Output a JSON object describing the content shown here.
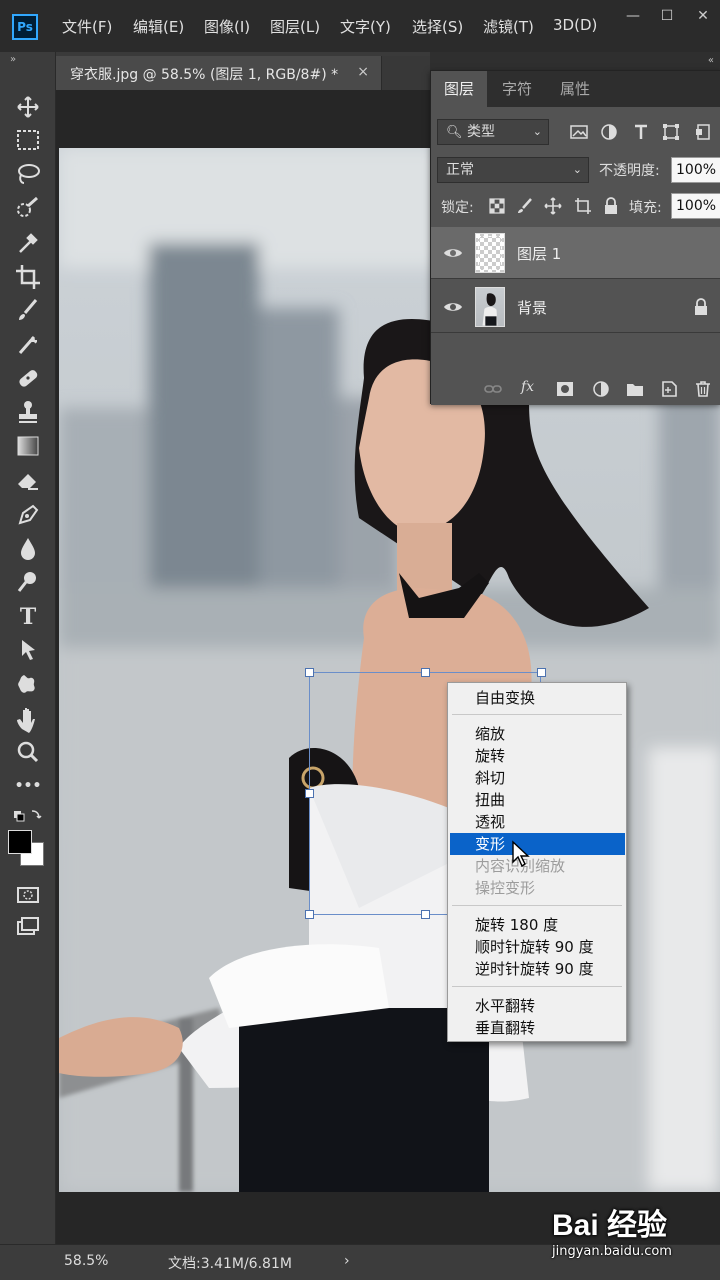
{
  "app": {
    "logo": "Ps"
  },
  "menubar": {
    "items": [
      "文件(F)",
      "编辑(E)",
      "图像(I)",
      "图层(L)",
      "文字(Y)",
      "选择(S)",
      "滤镜(T)",
      "3D(D)"
    ],
    "window_controls": [
      "—",
      "☐",
      "✕"
    ]
  },
  "document": {
    "tab_title": "穿衣服.jpg @ 58.5% (图层 1, RGB/8#) *",
    "tab_close": "×"
  },
  "toolbox": {
    "collapse": "»",
    "tools": [
      "move-tool",
      "marquee-tool",
      "lasso-tool",
      "quick-selection-tool",
      "eyedropper-tool",
      "crop-tool",
      "brush-tool",
      "healing-tool",
      "patch-tool",
      "stamp-tool",
      "gradient-tool",
      "eraser-tool",
      "pen-tool",
      "blur-tool",
      "dodge-tool",
      "type-tool",
      "path-selection-tool",
      "shape-tool",
      "hand-tool",
      "zoom-tool",
      "more-tools"
    ],
    "type_tool_glyph": "T",
    "more_glyph": "•••",
    "foreground_color": "#000000",
    "background_color": "#ffffff"
  },
  "layers_panel": {
    "collapse": "«",
    "tabs": [
      "图层",
      "字符",
      "属性"
    ],
    "active_tab": "图层",
    "filter": {
      "label": "类型"
    },
    "blend_mode": "正常",
    "opacity_label": "不透明度:",
    "opacity_value": "100%",
    "lock_label": "锁定:",
    "fill_label": "填充:",
    "fill_value": "100%",
    "layers": [
      {
        "name": "图层 1",
        "visible": true,
        "selected": true,
        "locked": false
      },
      {
        "name": "背景",
        "visible": true,
        "selected": false,
        "locked": true
      }
    ],
    "footer_fx": "fx"
  },
  "context_menu": {
    "groups": [
      [
        {
          "label": "自由变换",
          "enabled": true
        }
      ],
      [
        {
          "label": "缩放",
          "enabled": true
        },
        {
          "label": "旋转",
          "enabled": true
        },
        {
          "label": "斜切",
          "enabled": true
        },
        {
          "label": "扭曲",
          "enabled": true
        },
        {
          "label": "透视",
          "enabled": true
        },
        {
          "label": "变形",
          "enabled": true,
          "highlighted": true
        },
        {
          "label": "内容识别缩放",
          "enabled": false
        },
        {
          "label": "操控变形",
          "enabled": false
        }
      ],
      [
        {
          "label": "旋转 180 度",
          "enabled": true
        },
        {
          "label": "顺时针旋转 90 度",
          "enabled": true
        },
        {
          "label": "逆时针旋转 90 度",
          "enabled": true
        }
      ],
      [
        {
          "label": "水平翻转",
          "enabled": true
        },
        {
          "label": "垂直翻转",
          "enabled": true
        }
      ]
    ],
    "highlight_color": "#0a63c9"
  },
  "statusbar": {
    "zoom": "58.5%",
    "doc_info": "文档:3.41M/6.81M",
    "arrow": "›"
  },
  "watermark": {
    "logo": "Bai 经验",
    "url": "jingyan.baidu.com"
  }
}
